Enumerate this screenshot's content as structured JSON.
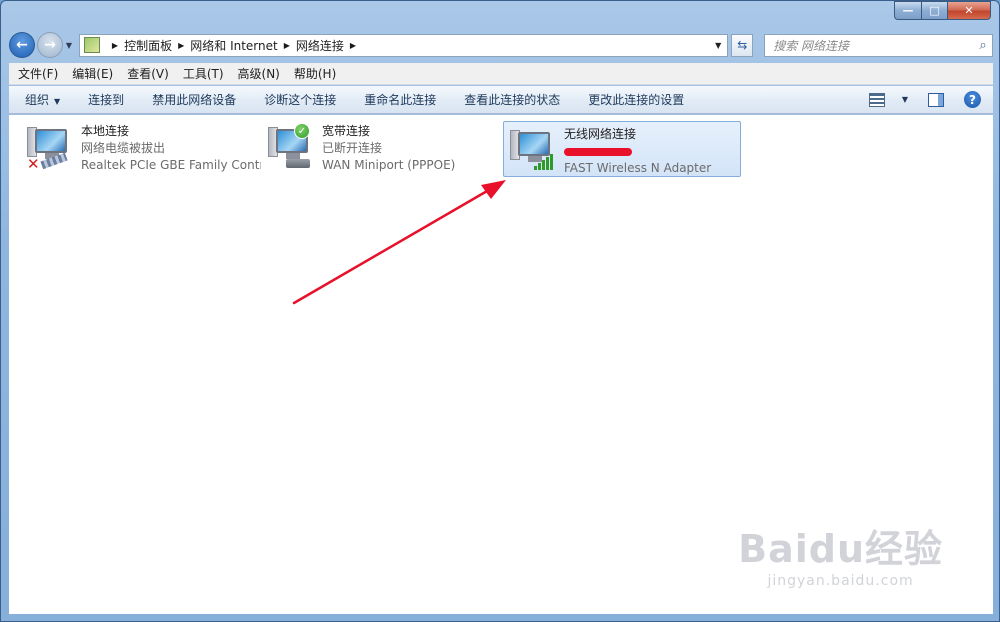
{
  "window": {
    "controls": {
      "minimize": "—",
      "maximize": "□",
      "close": "✕"
    }
  },
  "address": {
    "breadcrumbs": [
      "控制面板",
      "网络和 Internet",
      "网络连接"
    ],
    "search_placeholder": "搜索 网络连接"
  },
  "menu": [
    "文件(F)",
    "编辑(E)",
    "查看(V)",
    "工具(T)",
    "高级(N)",
    "帮助(H)"
  ],
  "commands": [
    "组织",
    "连接到",
    "禁用此网络设备",
    "诊断这个连接",
    "重命名此连接",
    "查看此连接的状态",
    "更改此连接的设置"
  ],
  "connections": [
    {
      "name": "本地连接",
      "status": "网络电缆被拔出",
      "device": "Realtek PCIe GBE Family Contr...",
      "state": "disconnected"
    },
    {
      "name": "宽带连接",
      "status": "已断开连接",
      "device": "WAN Miniport (PPPOE)",
      "state": "ok"
    },
    {
      "name": "无线网络连接",
      "status": "",
      "device": "FAST Wireless N Adapter",
      "state": "wireless",
      "selected": true
    }
  ],
  "watermark": {
    "logo": "Baidu经验",
    "url": "jingyan.baidu.com"
  },
  "colors": {
    "accent": "#2e5da0",
    "arrow": "#e8102a",
    "selection": "#d3e4f8"
  }
}
